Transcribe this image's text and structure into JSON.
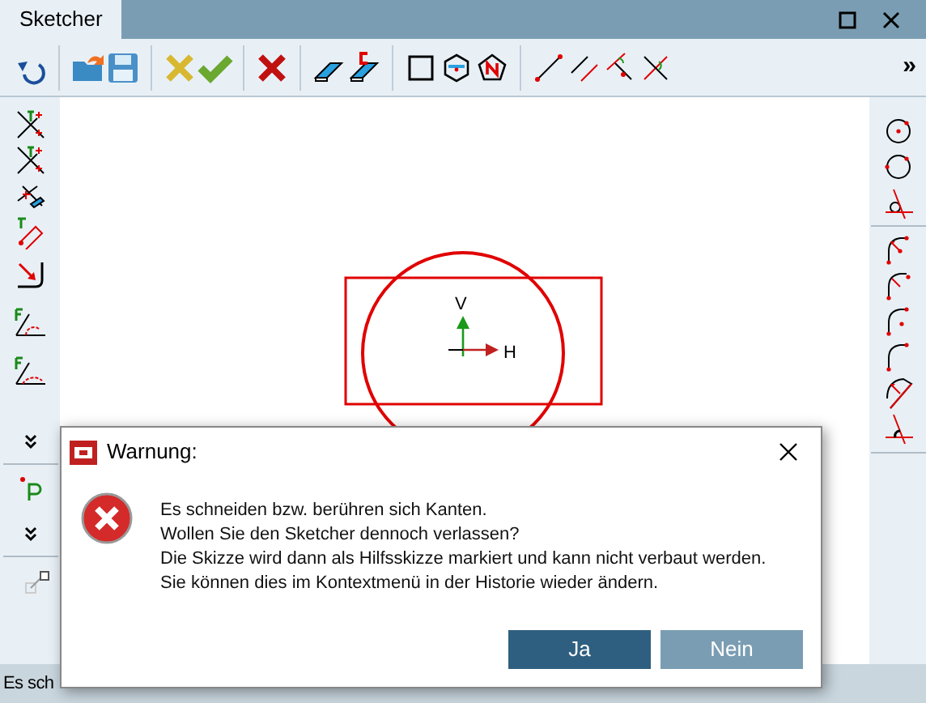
{
  "window": {
    "title": "Sketcher"
  },
  "toolbar": {
    "overflow": "»"
  },
  "canvas": {
    "axis_labels": [
      "V",
      "H"
    ]
  },
  "dialog": {
    "title": "Warnung:",
    "message": [
      "Es schneiden bzw. berühren sich Kanten.",
      "Wollen Sie den Sketcher dennoch verlassen?",
      "Die Skizze wird dann als Hilfsskizze markiert und kann nicht verbaut werden.",
      "Sie können dies im Kontextmenü in der Historie wieder ändern."
    ],
    "buttons": [
      {
        "label": "Ja",
        "selected": true
      },
      {
        "label": "Nein",
        "selected": false
      }
    ]
  },
  "status_bar": {
    "text": "Es sch"
  }
}
